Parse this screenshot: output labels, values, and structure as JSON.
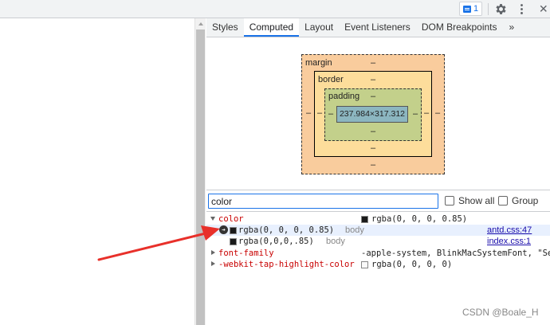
{
  "toolbar": {
    "issues_count": "1"
  },
  "tabs": [
    {
      "label": "Styles"
    },
    {
      "label": "Computed"
    },
    {
      "label": "Layout"
    },
    {
      "label": "Event Listeners"
    },
    {
      "label": "DOM Breakpoints"
    },
    {
      "label": "»"
    }
  ],
  "box_model": {
    "margin_label": "margin",
    "border_label": "border",
    "padding_label": "padding",
    "content_size": "237.984×317.312",
    "dash": "–"
  },
  "filter": {
    "value": "color",
    "show_all_label": "Show all",
    "group_label": "Group"
  },
  "properties": [
    {
      "name": "color",
      "value": "rgba(0, 0, 0, 0.85)",
      "expanded": true
    },
    {
      "name": "font-family",
      "value": "-apple-system, BlinkMacSystemFont, \"Se",
      "expanded": false
    },
    {
      "name": "-webkit-tap-highlight-color",
      "value": "rgba(0, 0, 0, 0)",
      "expanded": false
    }
  ],
  "color_traces": [
    {
      "value": "rgba(0, 0, 0, 0.85)",
      "selector": "body",
      "source": "antd.css:47"
    },
    {
      "value": "rgba(0,0,0,.85)",
      "selector": "body",
      "source": "index.css:1"
    }
  ],
  "watermark": "CSDN @Boale_H",
  "colors": {
    "accent": "#1a73e8",
    "margin": "#f9cc9d",
    "border": "#fddd9b",
    "padding": "#c3d08b",
    "content": "#8cb6c0",
    "arrow": "#e8302a"
  }
}
